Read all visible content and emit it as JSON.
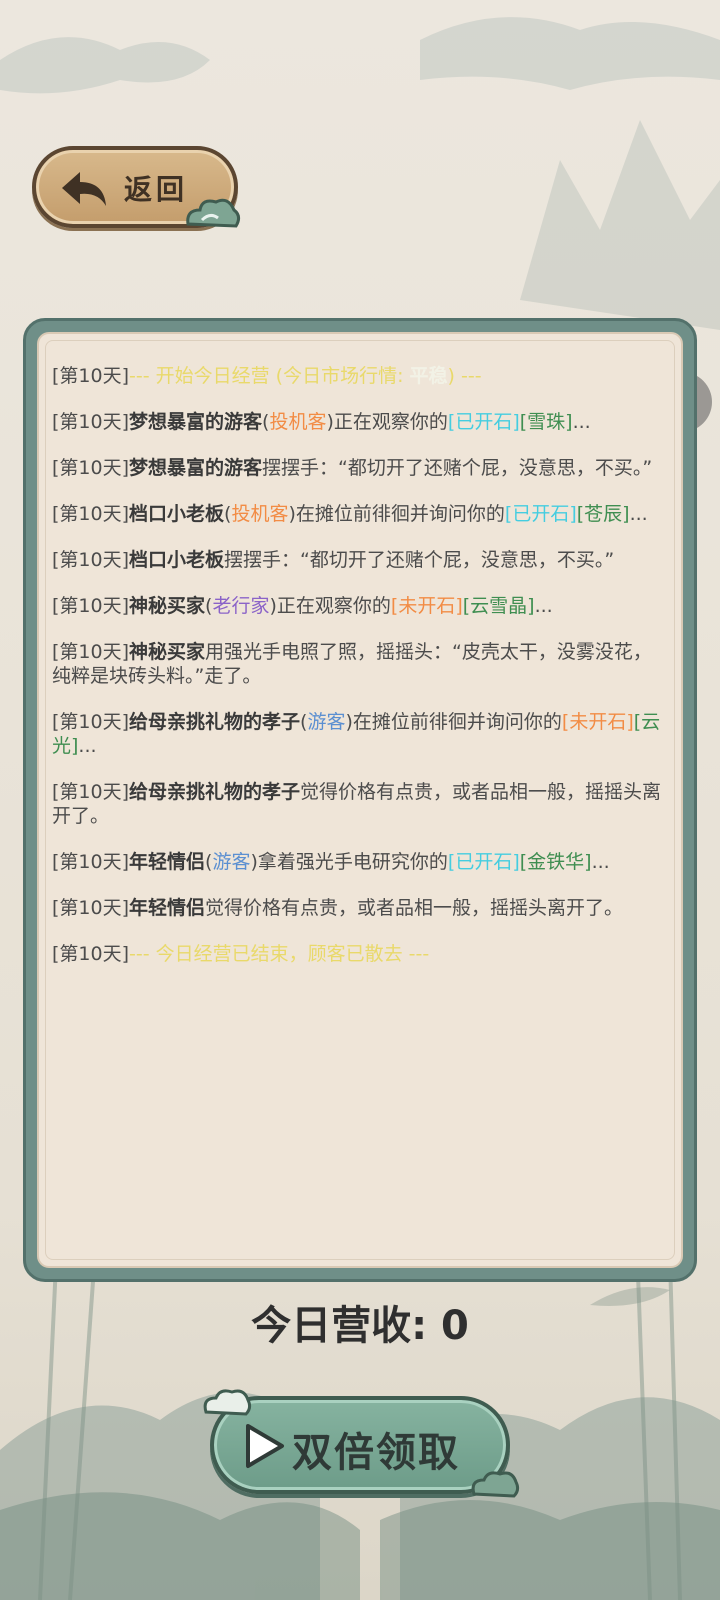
{
  "header": {
    "back_label": "返回"
  },
  "log": [
    {
      "day": "[第10天]",
      "system": "--- 开始今日经营 (今日市场行情: ",
      "market": "平稳",
      "system_end": ") ---"
    },
    {
      "day": "[第10天]",
      "actor": "梦想暴富的游客",
      "paren_open": "(",
      "tag": "投机客",
      "paren_close": ")",
      "action": "正在观察你的",
      "state": "[已开石]",
      "stone": "[雪珠]",
      "tail": "..."
    },
    {
      "day": "[第10天]",
      "actor": "梦想暴富的游客",
      "text": "摆摆手：“都切开了还赌个屁，没意思，不买。”"
    },
    {
      "day": "[第10天]",
      "actor": "档口小老板",
      "paren_open": "(",
      "tag": "投机客",
      "paren_close": ")",
      "action": "在摊位前徘徊并询问你的",
      "state": "[已开石]",
      "stone": "[苍辰]",
      "tail": "..."
    },
    {
      "day": "[第10天]",
      "actor": "档口小老板",
      "text": "摆摆手：“都切开了还赌个屁，没意思，不买。”"
    },
    {
      "day": "[第10天]",
      "actor": "神秘买家",
      "paren_open": "(",
      "tag": "老行家",
      "paren_close": ")",
      "action": "正在观察你的",
      "state": "[未开石]",
      "stone": "[云雪晶]",
      "tail": "..."
    },
    {
      "day": "[第10天]",
      "actor": "神秘买家",
      "text": "用强光手电照了照，摇摇头：“皮壳太干，没雾没花，纯粹是块砖头料。”走了。"
    },
    {
      "day": "[第10天]",
      "actor": "给母亲挑礼物的孝子",
      "paren_open": "(",
      "tag": "游客",
      "paren_close": ")",
      "action": "在摊位前徘徊并询问你的",
      "state": "[未开石]",
      "stone": "[云光]",
      "tail": "..."
    },
    {
      "day": "[第10天]",
      "actor": "给母亲挑礼物的孝子",
      "text": "觉得价格有点贵，或者品相一般，摇摇头离开了。"
    },
    {
      "day": "[第10天]",
      "actor": "年轻情侣",
      "paren_open": "(",
      "tag": "游客",
      "paren_close": ")",
      "action": "拿着强光手电研究你的",
      "state": "[已开石]",
      "stone": "[金铁华]",
      "tail": "..."
    },
    {
      "day": "[第10天]",
      "actor": "年轻情侣",
      "text": "觉得价格有点贵，或者品相一般，摇摇头离开了。"
    },
    {
      "day": "[第10天]",
      "system": "--- 今日经营已结束，顾客已散去 ---"
    }
  ],
  "revenue": {
    "text": "今日营收: 0"
  },
  "action_button": {
    "label": "双倍领取"
  },
  "colors": {
    "system": "#e9d96a",
    "tag_speculator": "#f28c45",
    "tag_expert": "#8b63c8",
    "tag_tourist": "#5b8fd1",
    "state": "#45cde0",
    "stone": "#3f8e51"
  }
}
